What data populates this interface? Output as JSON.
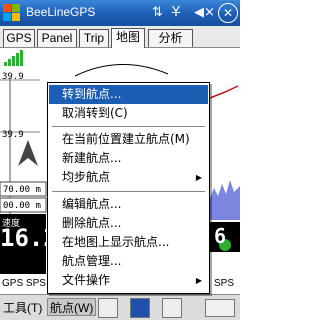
{
  "titlebar": {
    "app_title": "BeeLineGPS",
    "icons": [
      "signal-icon",
      "no-signal-icon",
      "volume-icon"
    ],
    "close_label": "✕"
  },
  "tabs": [
    {
      "label": "GPS",
      "active": false
    },
    {
      "label": "Panel",
      "active": false
    },
    {
      "label": "Trip",
      "active": false
    },
    {
      "label": "地图",
      "active": true
    },
    {
      "label": "分析",
      "active": false
    }
  ],
  "map": {
    "left_scale_top": "39.9",
    "left_scale_bottom": "39.9",
    "dist_left": "70.00 m",
    "dist_left2": "00.00 m",
    "speed_label": "速度",
    "speed_value": "16.2",
    "right_value": "6"
  },
  "info_row": {
    "left": "GPS SPS",
    "right": "SPS"
  },
  "menu": {
    "items": [
      {
        "label": "转到航点...",
        "highlighted": true,
        "submenu": false
      },
      {
        "label": "取消转到(C)",
        "highlighted": false,
        "submenu": false
      },
      {
        "label": "在当前位置建立航点(M)",
        "highlighted": false,
        "submenu": false
      },
      {
        "label": "新建航点...",
        "highlighted": false,
        "submenu": false
      },
      {
        "label": "均步航点",
        "highlighted": false,
        "submenu": true
      },
      {
        "label": "编辑航点...",
        "highlighted": false,
        "submenu": false
      },
      {
        "label": "删除航点...",
        "highlighted": false,
        "submenu": false
      },
      {
        "label": "在地图上显示航点...",
        "highlighted": false,
        "submenu": false
      },
      {
        "label": "航点管理...",
        "highlighted": false,
        "submenu": false
      },
      {
        "label": "文件操作",
        "highlighted": false,
        "submenu": true
      }
    ]
  },
  "cmdbar": {
    "tools_label": "工具(T)",
    "waypoint_label": "航点(W)"
  },
  "colors": {
    "titlebar": "#1d5eb5",
    "highlight": "#1d5eb5",
    "signal_green": "#2db02d"
  }
}
